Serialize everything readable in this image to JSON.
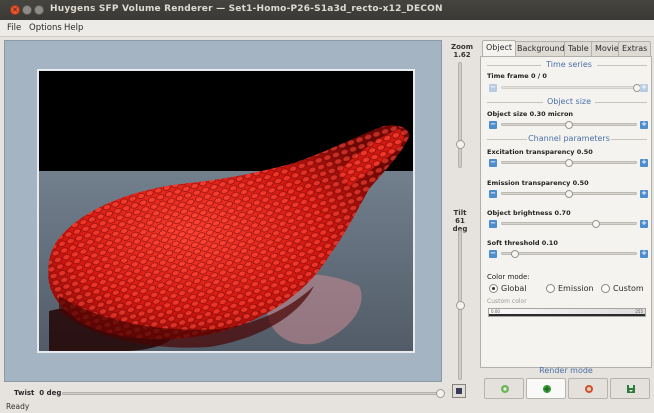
{
  "window": {
    "title": "Huygens SFP Volume Renderer — Set1-Homo-P26-S1a3d_recto-x12_DECON",
    "close_glyph": "✕"
  },
  "menu": {
    "file": "File",
    "options": "Options",
    "help": "Help"
  },
  "viewer": {
    "zoom_label": "Zoom",
    "zoom_value": "1.62",
    "zoom_level": 0.26,
    "tilt_label": "Tilt",
    "tilt_value": "61 deg",
    "tilt_level": 0.5,
    "twist_label": "Twist",
    "twist_value": "0 deg",
    "twist_level": 1.0
  },
  "status": "Ready",
  "tabs": [
    "Object",
    "Background",
    "Table",
    "Movie",
    "Extras"
  ],
  "active_tab": 0,
  "sections": {
    "time_series": "Time series",
    "object_size": "Object size",
    "channel_parameters": "Channel parameters",
    "render_mode": "Render mode"
  },
  "params": {
    "time_frame": {
      "label": "Time frame  0 / 0",
      "level": 1.0,
      "enabled": false
    },
    "object_size": {
      "label": "Object size 0.30 micron",
      "level": 0.5
    },
    "excitation": {
      "label": "Excitation transparency 0.50",
      "level": 0.5
    },
    "emission": {
      "label": "Emission transparency 0.50",
      "level": 0.5
    },
    "brightness": {
      "label": "Object brightness 0.70",
      "level": 0.7
    },
    "soft_threshold": {
      "label": "Soft threshold 0.10",
      "level": 0.1
    }
  },
  "color_mode": {
    "label": "Color mode:",
    "options": [
      "Global",
      "Emission",
      "Custom"
    ],
    "selected": "Global",
    "custom_label": "Custom color",
    "bar_min": "0.00",
    "bar_max": "255"
  },
  "render_buttons": [
    {
      "icon": "render-fast-icon",
      "color": "#6fb45a"
    },
    {
      "icon": "render-quality-icon",
      "color": "#3a9b3a"
    },
    {
      "icon": "render-snapshot-icon",
      "color": "#c9542e"
    },
    {
      "icon": "save-image-icon",
      "color": "#2f7a3a"
    }
  ]
}
